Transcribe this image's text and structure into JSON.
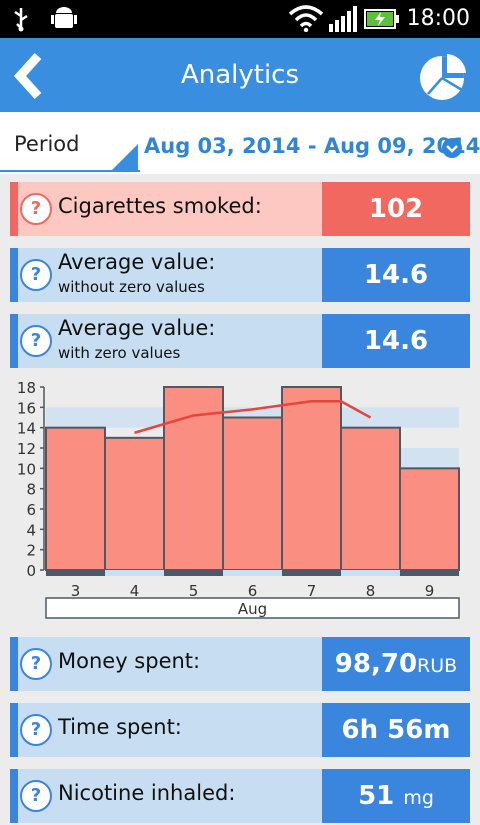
{
  "status_bar": {
    "time": "18:00"
  },
  "header": {
    "title": "Analytics",
    "back_icon": "chevron-left-icon",
    "action_icon": "pie-chart-icon"
  },
  "period": {
    "label": "Period",
    "value": "Aug 03, 2014 - Aug 09, 2014"
  },
  "stats": {
    "cigarettes": {
      "label": "Cigarettes smoked:",
      "value": "102"
    },
    "avg_nonzero": {
      "label": "Average value:",
      "sublabel": "without zero values",
      "value": "14.6"
    },
    "avg_zero": {
      "label": "Average value:",
      "sublabel": "with zero values",
      "value": "14.6"
    },
    "money": {
      "label": "Money spent:",
      "value": "98,70",
      "unit": "RUB"
    },
    "time": {
      "label": "Time spent:",
      "value": "6h 56m"
    },
    "nicotine": {
      "label": "Nicotine inhaled:",
      "value": "51",
      "unit": "mg"
    }
  },
  "help_glyph": "?",
  "colors": {
    "accent": "#3a85de",
    "alert": "#f0685f",
    "bar": "#fa8e80",
    "trend": "#e6453c"
  },
  "chart_data": {
    "type": "bar",
    "categories": [
      "3",
      "4",
      "5",
      "6",
      "7",
      "8",
      "9"
    ],
    "values": [
      14,
      13,
      18,
      15,
      18,
      14,
      10
    ],
    "trend": [
      13.5,
      15.2,
      15.8,
      16.6,
      16.6,
      15.0
    ],
    "trend_x": [
      "4",
      "5",
      "6",
      "7",
      "7.5",
      "8"
    ],
    "xlabel": "Aug",
    "ylim": [
      0,
      18
    ],
    "yticks": [
      0,
      2,
      4,
      6,
      8,
      10,
      12,
      14,
      16,
      18
    ]
  }
}
